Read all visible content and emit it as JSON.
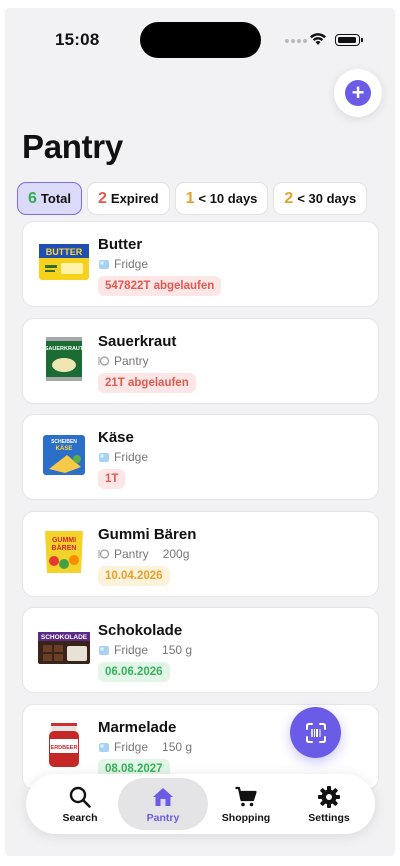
{
  "status": {
    "time": "15:08"
  },
  "page": {
    "title": "Pantry"
  },
  "filters": [
    {
      "num": "6",
      "label": "Total",
      "color": "#2fae4e",
      "active": true
    },
    {
      "num": "2",
      "label": "Expired",
      "color": "#e05a4f",
      "active": false
    },
    {
      "num": "1",
      "label": "< 10 days",
      "color": "#e4a22b",
      "active": false
    },
    {
      "num": "2",
      "label": "< 30 days",
      "color": "#e4a22b",
      "active": false
    }
  ],
  "items": [
    {
      "name": "Butter",
      "location": "Fridge",
      "location_icon": "ice-cube-icon",
      "quantity": "",
      "badge": "547822T abgelaufen",
      "badge_type": "red"
    },
    {
      "name": "Sauerkraut",
      "location": "Pantry",
      "location_icon": "plate-icon",
      "quantity": "",
      "badge": "21T abgelaufen",
      "badge_type": "red"
    },
    {
      "name": "Käse",
      "location": "Fridge",
      "location_icon": "ice-cube-icon",
      "quantity": "",
      "badge": "1T",
      "badge_type": "red"
    },
    {
      "name": "Gummi Bären",
      "location": "Pantry",
      "location_icon": "plate-icon",
      "quantity": "200g",
      "badge": "10.04.2026",
      "badge_type": "amber"
    },
    {
      "name": "Schokolade",
      "location": "Fridge",
      "location_icon": "ice-cube-icon",
      "quantity": "150 g",
      "badge": "06.06.2026",
      "badge_type": "green"
    },
    {
      "name": "Marmelade",
      "location": "Fridge",
      "location_icon": "ice-cube-icon",
      "quantity": "150 g",
      "badge": "08.08.2027",
      "badge_type": "green"
    }
  ],
  "product_labels": {
    "butter": "BUTTER",
    "sauerkraut": "SAUERKRAUT",
    "kaese": "SCHEIBEN KÄSE",
    "gummi": "GUMMI BÄREN",
    "schokolade": "SCHOKOLADE",
    "marmelade": "ERDBEER"
  },
  "tabs": [
    {
      "label": "Search",
      "icon": "magnifier-icon",
      "active": false
    },
    {
      "label": "Pantry",
      "icon": "house-icon",
      "active": true
    },
    {
      "label": "Shopping",
      "icon": "cart-icon",
      "active": false
    },
    {
      "label": "Settings",
      "icon": "gear-icon",
      "active": false
    }
  ],
  "colors": {
    "accent": "#6b5ce7",
    "expired": "#e05a4f",
    "soon": "#e4a22b",
    "ok": "#38b35a"
  }
}
